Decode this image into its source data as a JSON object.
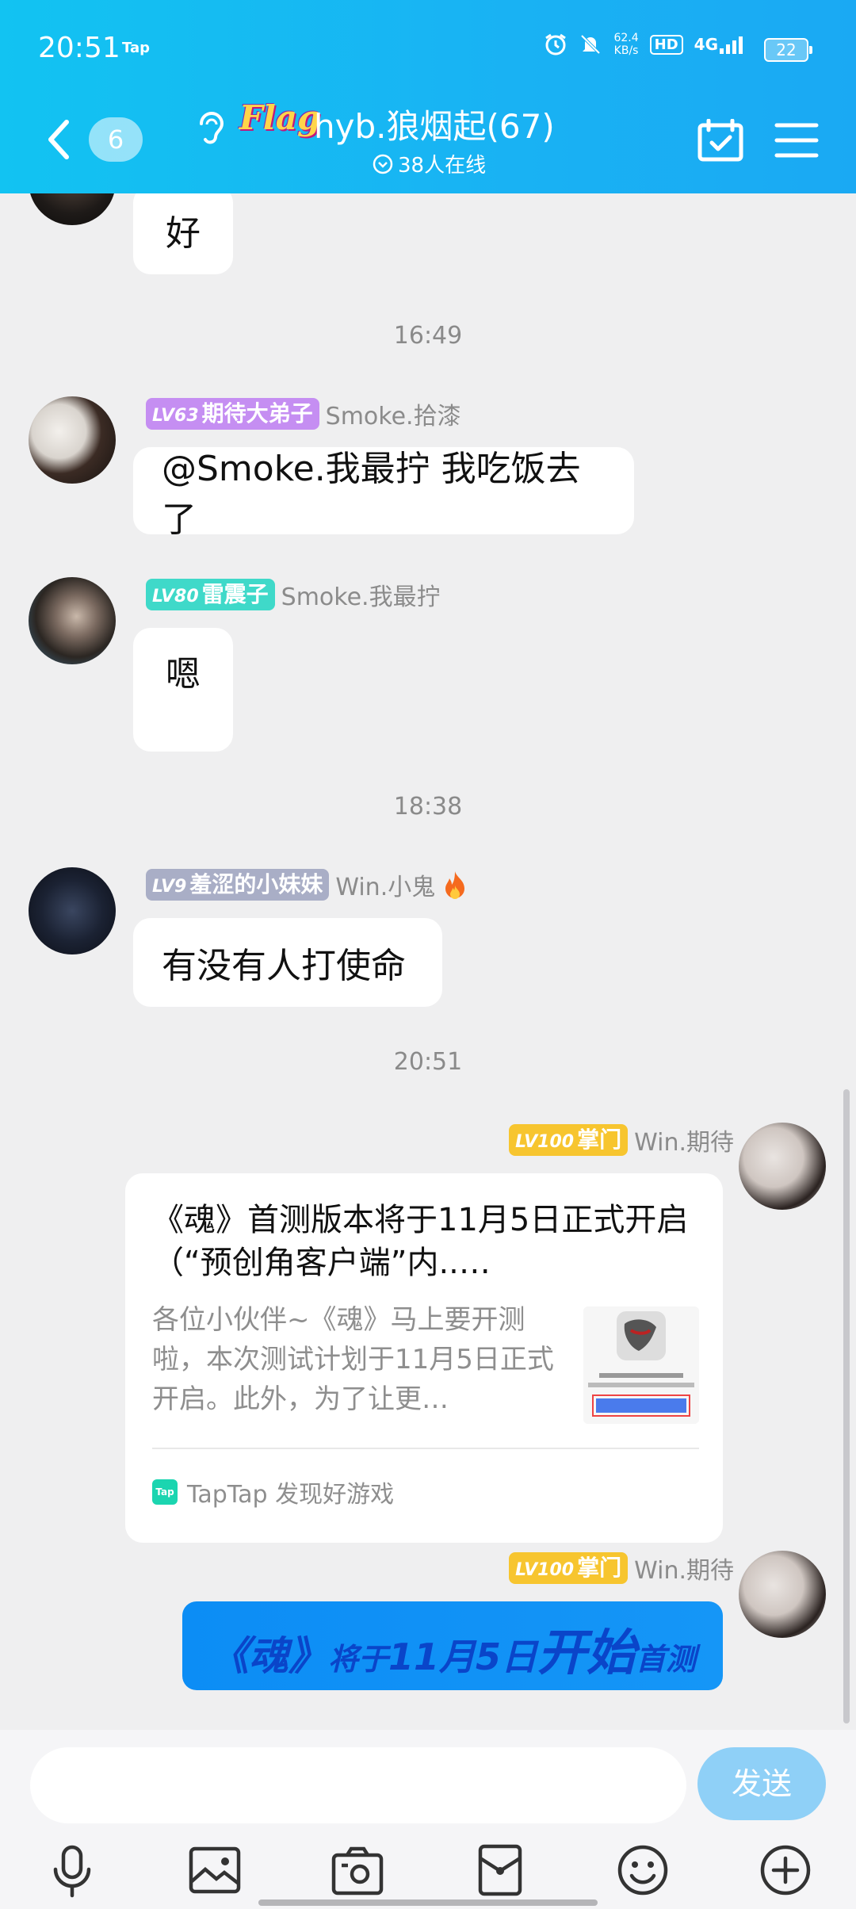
{
  "status_bar": {
    "time": "20:51",
    "app_tag": "Tap",
    "net_speed_value": "62.4",
    "net_speed_unit": "KB/s",
    "hd": "HD",
    "network": "4G",
    "battery": "22"
  },
  "header": {
    "unread_count": "6",
    "flag_label": "Flag",
    "title": "hyb.狼烟起(67)",
    "online": "38人在线"
  },
  "messages": [
    {
      "text": "好"
    },
    {
      "time": "16:49"
    },
    {
      "lv": "LV63",
      "rank": "期待大弟子",
      "name": "Smoke.拾漆",
      "text": "@Smoke.我最拧 我吃饭去了",
      "badge_color": "#c58ef2"
    },
    {
      "lv": "LV80",
      "rank": "雷震子",
      "name": "Smoke.我最拧",
      "text": "嗯",
      "badge_color": "#3fd9c9"
    },
    {
      "time": "18:38"
    },
    {
      "lv": "LV9",
      "rank": "羞涩的小妹妹",
      "name": "Win.小鬼",
      "text": "有没有人打使命",
      "badge_color": "#a9aec6"
    },
    {
      "time": "20:51"
    },
    {
      "lv": "LV100",
      "rank": "掌门",
      "name": "Win.期待",
      "badge_color": "#f7c52f"
    },
    {
      "lv": "LV100",
      "rank": "掌门",
      "name": "Win.期待",
      "badge_color": "#f7c52f"
    }
  ],
  "share_card": {
    "title": "《魂》首测版本将于11月5日正式开启（“预创角客户端”内..…",
    "description": "各位小伙伴~《魂》马上要开测啦，本次测试计划于11月5日正式开启。此外，为了让更…",
    "source_logo": "Tap",
    "source": "TapTap  发现好游戏"
  },
  "banner": {
    "part1": "《魂》",
    "part2": "将于",
    "part3": "11月5日",
    "part4": "开始",
    "part5": "首测"
  },
  "input": {
    "placeholder": "",
    "send": "发送"
  },
  "toolbar_icons": [
    "mic-icon",
    "image-icon",
    "camera-icon",
    "red-packet-icon",
    "emoji-icon",
    "plus-icon"
  ],
  "colors": {
    "header_start": "#12c3f2",
    "header_end": "#1aa9f3",
    "send_button": "#8fd0f7",
    "banner": "#0c8df5"
  }
}
